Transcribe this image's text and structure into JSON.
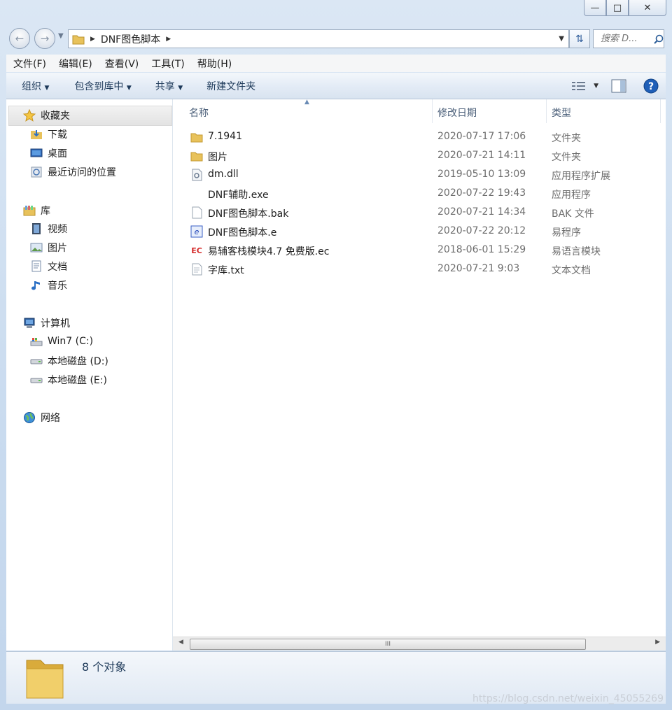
{
  "window": {
    "min_glyph": "—",
    "max_glyph": "□",
    "close_glyph": "✕"
  },
  "address": {
    "path_segment": "DNF图色脚本",
    "search_placeholder": "搜索 D..."
  },
  "menu": [
    "文件(F)",
    "编辑(E)",
    "查看(V)",
    "工具(T)",
    "帮助(H)"
  ],
  "toolbar": {
    "organize": "组织",
    "include_in_library": "包含到库中",
    "share": "共享",
    "new_folder": "新建文件夹"
  },
  "sidebar": {
    "favorites": {
      "label": "收藏夹",
      "items": [
        "下载",
        "桌面",
        "最近访问的位置"
      ]
    },
    "libraries": {
      "label": "库",
      "items": [
        "视频",
        "图片",
        "文档",
        "音乐"
      ]
    },
    "computer": {
      "label": "计算机",
      "items": [
        "Win7 (C:)",
        "本地磁盘 (D:)",
        "本地磁盘 (E:)"
      ]
    },
    "network": {
      "label": "网络"
    }
  },
  "columns": {
    "name": "名称",
    "date": "修改日期",
    "type": "类型"
  },
  "files": [
    {
      "name": "7.1941",
      "date": "2020-07-17 17:06",
      "type": "文件夹",
      "icon": "folder-icon"
    },
    {
      "name": "图片",
      "date": "2020-07-21 14:11",
      "type": "文件夹",
      "icon": "folder-icon"
    },
    {
      "name": "dm.dll",
      "date": "2019-05-10 13:09",
      "type": "应用程序扩展",
      "icon": "dll-icon"
    },
    {
      "name": "DNF辅助.exe",
      "date": "2020-07-22 19:43",
      "type": "应用程序",
      "icon": "exe-icon"
    },
    {
      "name": "DNF图色脚本.bak",
      "date": "2020-07-21 14:34",
      "type": "BAK 文件",
      "icon": "blank-file-icon"
    },
    {
      "name": "DNF图色脚本.e",
      "date": "2020-07-22 20:12",
      "type": "易程序",
      "icon": "e-program-icon"
    },
    {
      "name": "易辅客栈模块4.7 免费版.ec",
      "date": "2018-06-01 15:29",
      "type": "易语言模块",
      "icon": "ec-module-icon"
    },
    {
      "name": "字库.txt",
      "date": "2020-07-21 9:03",
      "type": "文本文档",
      "icon": "text-file-icon"
    }
  ],
  "scroll_grip": "III",
  "status": {
    "count": "8 个对象"
  },
  "watermark": "https://blog.csdn.net/weixin_45055269",
  "colors": {
    "folder": "#e8c25b",
    "accent": "#2d5b9a",
    "help": "#1f5fb8"
  }
}
